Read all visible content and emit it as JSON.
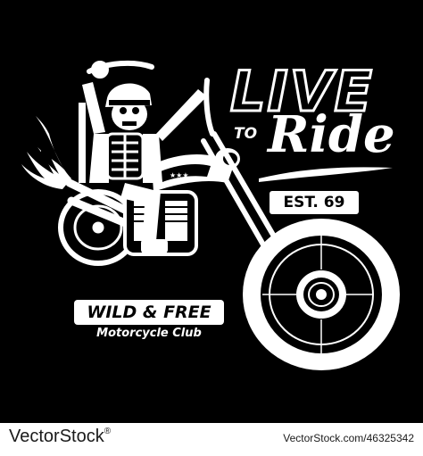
{
  "headline": {
    "live": "LIVE",
    "to": "TO",
    "ride": "Ride"
  },
  "badges": {
    "est": "EST. 69",
    "wild_free": "WILD & FREE",
    "club": "Motorcycle Club"
  },
  "footer": {
    "brand": "VectorStock",
    "reg_mark": "®",
    "url_id": "VectorStock.com/46325342"
  },
  "colors": {
    "background": "#000000",
    "foreground": "#ffffff",
    "footer_bg": "#ffffff",
    "footer_text": "#1a1a1a"
  }
}
